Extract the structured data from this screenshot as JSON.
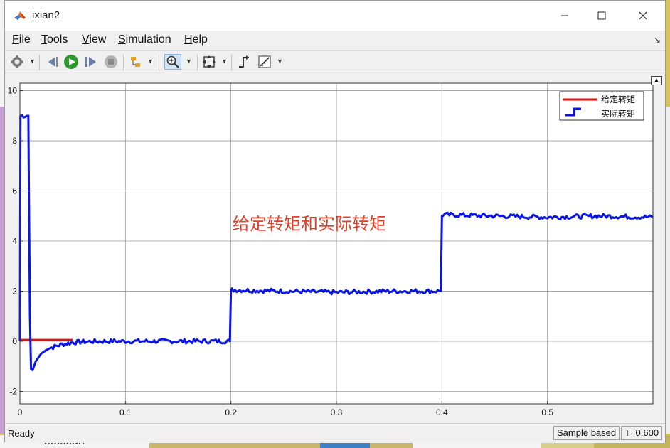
{
  "window": {
    "title": "ixian2"
  },
  "menu": {
    "file": "File",
    "tools": "Tools",
    "view": "View",
    "simulation": "Simulation",
    "help": "Help"
  },
  "status": {
    "ready": "Ready",
    "sample_mode": "Sample based",
    "time": "T=0.600"
  },
  "background_fragments": {
    "bottom_label": "boolean"
  },
  "colors": {
    "reference": "#e01010",
    "actual": "#0a14e6",
    "annotation": "#e0402a"
  },
  "chart_data": {
    "type": "line",
    "title": "",
    "annotation": "给定转矩和实际转矩",
    "xlim": [
      0,
      0.6
    ],
    "ylim": [
      -2.5,
      10.3
    ],
    "xticks": [
      0,
      0.1,
      0.2,
      0.3,
      0.4,
      0.5
    ],
    "xtick_labels": [
      "0",
      "0.1",
      "0.2",
      "0.3",
      "0.4",
      "0.5"
    ],
    "yticks": [
      -2,
      0,
      2,
      4,
      6,
      8,
      10
    ],
    "ytick_labels": [
      "-2",
      "0",
      "2",
      "4",
      "6",
      "8",
      "10"
    ],
    "grid": true,
    "legend_position": "top-right",
    "series": [
      {
        "name": "给定转矩",
        "color": "#e01010",
        "x": [
          0,
          0.05
        ],
        "y": [
          0.05,
          0.05
        ]
      },
      {
        "name": "实际转矩",
        "color": "#0a14e6",
        "x": [
          0,
          0.0005,
          0.008,
          0.0085,
          0.0095,
          0.0105,
          0.012,
          0.015,
          0.02,
          0.025,
          0.03,
          0.04,
          0.05,
          0.06,
          0.08,
          0.1,
          0.15,
          0.199,
          0.2,
          0.201,
          0.25,
          0.3,
          0.35,
          0.399,
          0.4,
          0.401,
          0.45,
          0.5,
          0.55,
          0.6
        ],
        "y": [
          0,
          9,
          9,
          6,
          1,
          -1.1,
          -1.15,
          -0.8,
          -0.5,
          -0.35,
          -0.25,
          -0.12,
          -0.05,
          -0.02,
          0,
          0,
          0,
          0,
          2,
          2.05,
          2,
          1.95,
          2,
          2,
          5,
          5.05,
          5,
          4.95,
          5,
          4.95
        ]
      }
    ]
  }
}
